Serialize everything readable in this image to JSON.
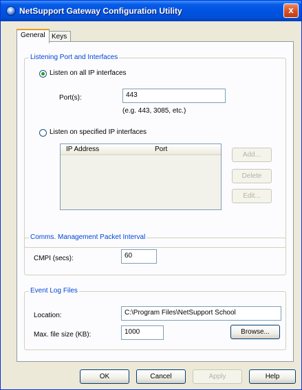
{
  "window": {
    "title": "NetSupport Gateway Configuration Utility",
    "close_glyph": "x"
  },
  "tabs": [
    {
      "label": "General"
    },
    {
      "label": "Keys"
    }
  ],
  "listening": {
    "group_title": "Listening Port and Interfaces",
    "radio_all_label": "Listen on all IP interfaces",
    "ports_label": "Port(s):",
    "ports_value": "443",
    "ports_hint": "(e.g. 443, 3085, etc.)",
    "radio_specified_label": "Listen on specified IP interfaces",
    "list_columns": [
      "IP Address",
      "Port"
    ],
    "add_label": "Add...",
    "delete_label": "Delete",
    "edit_label": "Edit..."
  },
  "cmpi": {
    "group_title": "Comms. Management Packet Interval",
    "label": "CMPI (secs):",
    "value": "60"
  },
  "eventlog": {
    "group_title": "Event Log Files",
    "location_label": "Location:",
    "location_value": "C:\\Program Files\\NetSupport School",
    "maxsize_label": "Max. file size (KB):",
    "maxsize_value": "1000",
    "browse_label": "Browse..."
  },
  "footer": {
    "ok_label": "OK",
    "cancel_label": "Cancel",
    "apply_label": "Apply",
    "help_label": "Help"
  }
}
